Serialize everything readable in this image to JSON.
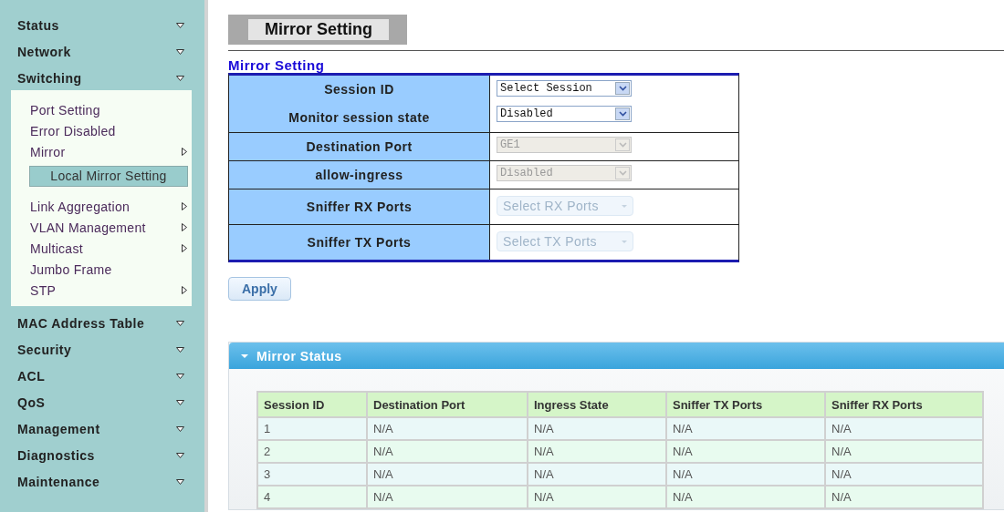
{
  "sidebar": {
    "items": [
      {
        "label": "Status"
      },
      {
        "label": "Network"
      },
      {
        "label": "Switching",
        "expanded": true,
        "children": [
          {
            "label": "Port Setting",
            "kind": "page"
          },
          {
            "label": "Error Disabled",
            "kind": "page"
          },
          {
            "label": "Mirror",
            "kind": "submenu",
            "expanded": true,
            "children": [
              {
                "label": "Local Mirror Setting",
                "selected": true
              }
            ]
          },
          {
            "label": "Link Aggregation",
            "kind": "submenu"
          },
          {
            "label": "VLAN Management",
            "kind": "submenu"
          },
          {
            "label": "Multicast",
            "kind": "submenu"
          },
          {
            "label": "Jumbo Frame",
            "kind": "page"
          },
          {
            "label": "STP",
            "kind": "submenu"
          }
        ]
      },
      {
        "label": "MAC Address Table"
      },
      {
        "label": "Security"
      },
      {
        "label": "ACL"
      },
      {
        "label": "QoS"
      },
      {
        "label": "Management"
      },
      {
        "label": "Diagnostics"
      },
      {
        "label": "Maintenance"
      }
    ]
  },
  "page_title": "Mirror Setting",
  "form": {
    "title": "Mirror Setting",
    "groups": [
      {
        "fields": [
          {
            "label": "Session ID",
            "control": {
              "kind": "select",
              "value": "Select Session",
              "disabled": false
            }
          },
          {
            "label": "Monitor session state",
            "control": {
              "kind": "select",
              "value": "Disabled",
              "disabled": false
            }
          }
        ]
      },
      {
        "fields": [
          {
            "label": "Destination Port",
            "control": {
              "kind": "select",
              "value": "GE1",
              "disabled": true
            }
          }
        ]
      },
      {
        "fields": [
          {
            "label": "allow-ingress",
            "control": {
              "kind": "select",
              "value": "Disabled",
              "disabled": true
            }
          }
        ]
      },
      {
        "fields": [
          {
            "label": "Sniffer RX Ports",
            "control": {
              "kind": "multiselect",
              "placeholder": "Select RX Ports",
              "disabled": true
            }
          }
        ]
      },
      {
        "fields": [
          {
            "label": "Sniffer TX Ports",
            "control": {
              "kind": "multiselect",
              "placeholder": "Select TX Ports",
              "disabled": true
            }
          }
        ]
      }
    ],
    "apply_button": "Apply"
  },
  "status_panel": {
    "title": "Mirror Status",
    "expanded": true,
    "table": {
      "columns": [
        "Session ID",
        "Destination Port",
        "Ingress State",
        "Sniffer TX Ports",
        "Sniffer RX Ports"
      ],
      "rows": [
        [
          "1",
          "N/A",
          "N/A",
          "N/A",
          "N/A"
        ],
        [
          "2",
          "N/A",
          "N/A",
          "N/A",
          "N/A"
        ],
        [
          "3",
          "N/A",
          "N/A",
          "N/A",
          "N/A"
        ],
        [
          "4",
          "N/A",
          "N/A",
          "N/A",
          "N/A"
        ]
      ]
    }
  }
}
